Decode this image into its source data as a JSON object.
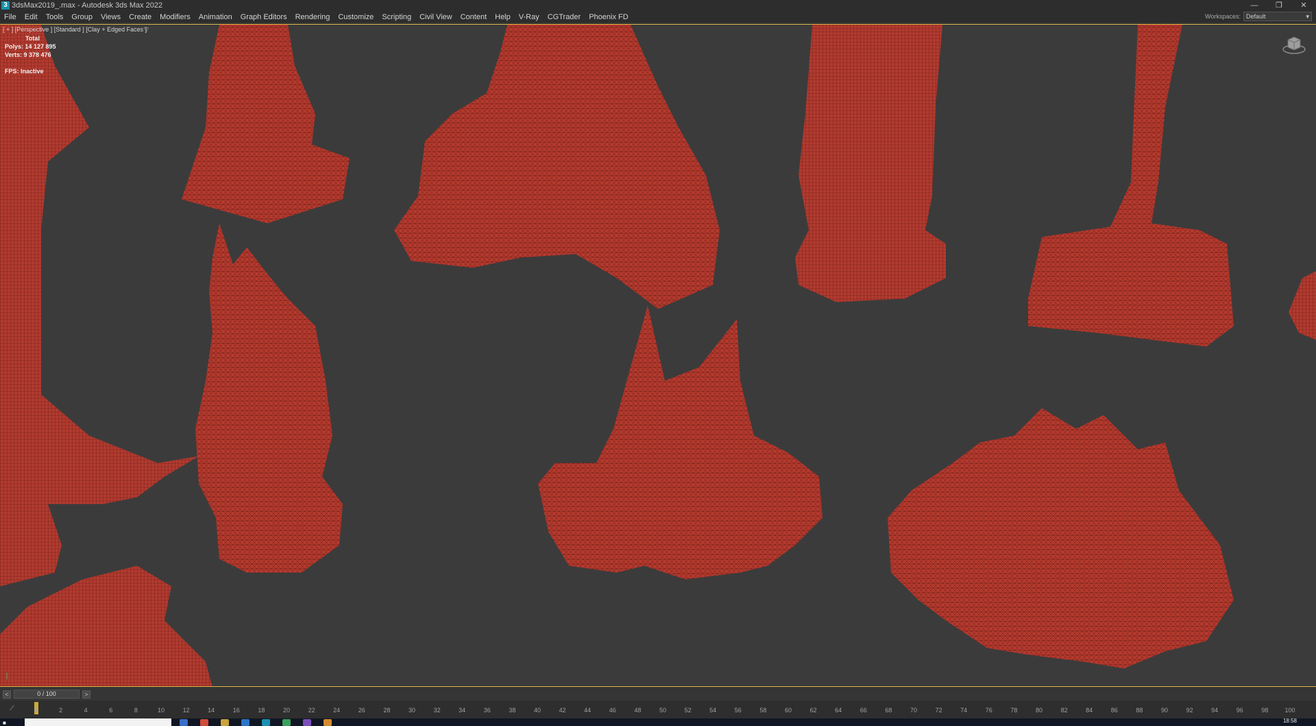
{
  "window": {
    "title": "3dsMax2019_.max - Autodesk 3ds Max 2022",
    "app_icon": "3",
    "minimize": "—",
    "restore": "❐",
    "close": "✕"
  },
  "menu": {
    "items": [
      "File",
      "Edit",
      "Tools",
      "Group",
      "Views",
      "Create",
      "Modifiers",
      "Animation",
      "Graph Editors",
      "Rendering",
      "Customize",
      "Scripting",
      "Civil View",
      "Content",
      "Help",
      "V-Ray",
      "CGTrader",
      "Phoenix FD"
    ],
    "workspaces_label": "Workspaces:",
    "workspaces_value": "Default"
  },
  "viewport": {
    "label": "[ + ] [Perspective ] [Standard ] [Clay + Edged Faces ]",
    "filter_icon": "▽",
    "stats_total": "Total",
    "polys": "Polys:  14 127 895",
    "verts": "Verts:  9 378 476",
    "fps": "FPS:    Inactive",
    "mesh_color": "#b0362b",
    "bg_color": "#3b3b3b"
  },
  "timeline": {
    "prev": "<",
    "next": ">",
    "frame_display": "0 / 100",
    "ticks": [
      "0",
      "2",
      "4",
      "6",
      "8",
      "10",
      "12",
      "14",
      "16",
      "18",
      "20",
      "22",
      "24",
      "26",
      "28",
      "30",
      "32",
      "34",
      "36",
      "38",
      "40",
      "42",
      "44",
      "46",
      "48",
      "50",
      "52",
      "54",
      "56",
      "58",
      "60",
      "62",
      "64",
      "66",
      "68",
      "70",
      "72",
      "74",
      "76",
      "78",
      "80",
      "82",
      "84",
      "86",
      "88",
      "90",
      "92",
      "94",
      "96",
      "98",
      "100"
    ],
    "accent": "#e2b94a"
  },
  "taskbar": {
    "clock": "18:58"
  }
}
